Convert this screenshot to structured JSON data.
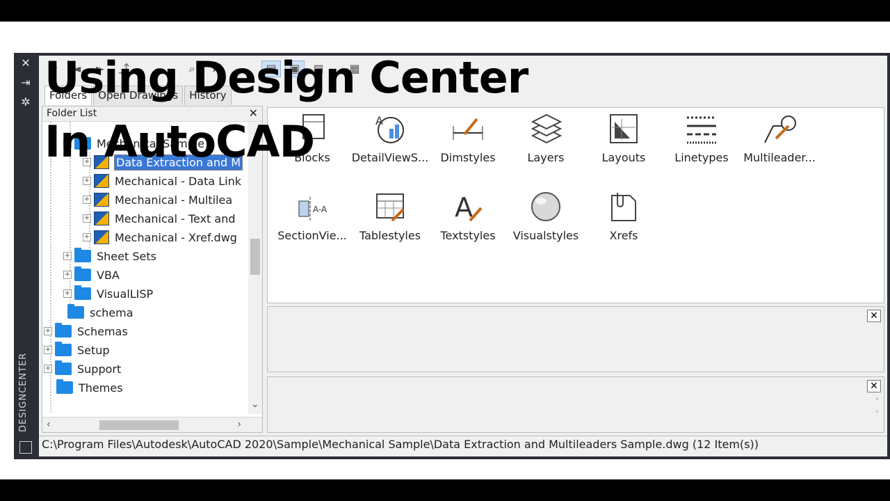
{
  "overlay": {
    "line1": "Using Design Center",
    "line2": "In AutoCAD"
  },
  "window": {
    "side_title": "DESIGNCENTER"
  },
  "tabs": [
    {
      "label": "Folders",
      "active": true
    },
    {
      "label": "Open Drawings",
      "active": false
    },
    {
      "label": "History",
      "active": false
    }
  ],
  "folder_list": {
    "header": "Folder List",
    "items": [
      {
        "label": "Mechanical Sample",
        "icon": "folder-icon"
      },
      {
        "label": "Data Extraction and M",
        "icon": "dwg-icon",
        "selected": true
      },
      {
        "label": "Mechanical - Data Link",
        "icon": "dwg-icon"
      },
      {
        "label": "Mechanical - Multilea",
        "icon": "dwg-icon"
      },
      {
        "label": "Mechanical - Text and",
        "icon": "dwg-icon"
      },
      {
        "label": "Mechanical - Xref.dwg",
        "icon": "dwg-icon"
      },
      {
        "label": "Sheet Sets",
        "icon": "folder-icon"
      },
      {
        "label": "VBA",
        "icon": "folder-icon"
      },
      {
        "label": "VisualLISP",
        "icon": "folder-icon"
      },
      {
        "label": "schema",
        "icon": "folder-icon"
      },
      {
        "label": "Schemas",
        "icon": "folder-icon"
      },
      {
        "label": "Setup",
        "icon": "folder-icon"
      },
      {
        "label": "Support",
        "icon": "folder-icon"
      },
      {
        "label": "Themes",
        "icon": "folder-icon"
      }
    ]
  },
  "content_items": [
    {
      "label": "Blocks",
      "icon": "blocks-icon"
    },
    {
      "label": "DetailViewS...",
      "icon": "detail-view-icon"
    },
    {
      "label": "Dimstyles",
      "icon": "dimstyles-icon"
    },
    {
      "label": "Layers",
      "icon": "layers-icon"
    },
    {
      "label": "Layouts",
      "icon": "layouts-icon"
    },
    {
      "label": "Linetypes",
      "icon": "linetypes-icon"
    },
    {
      "label": "Multileader...",
      "icon": "multileader-icon"
    },
    {
      "label": "SectionVie...",
      "icon": "section-view-icon"
    },
    {
      "label": "Tablestyles",
      "icon": "tablestyles-icon"
    },
    {
      "label": "Textstyles",
      "icon": "textstyles-icon"
    },
    {
      "label": "Visualstyles",
      "icon": "visualstyles-icon"
    },
    {
      "label": "Xrefs",
      "icon": "xrefs-icon"
    }
  ],
  "status": "C:\\Program Files\\Autodesk\\AutoCAD 2020\\Sample\\Mechanical Sample\\Data Extraction and Multileaders Sample.dwg (12 Item(s))",
  "colors": {
    "frame": "#2b2f35",
    "folder": "#1e88e5",
    "selection": "#3a78d6"
  }
}
